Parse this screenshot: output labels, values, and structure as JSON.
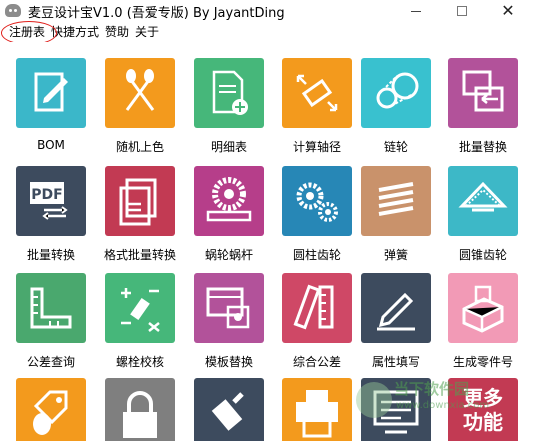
{
  "window": {
    "title": "麦豆设计宝V1.0 (吾爱专版) By JayantDing"
  },
  "menubar": {
    "items": [
      {
        "label": "注册表"
      },
      {
        "label": "快捷方式"
      },
      {
        "label": "赞助"
      },
      {
        "label": "关于"
      }
    ]
  },
  "tiles": [
    {
      "label": "BOM",
      "icon": "edit-document-icon",
      "color": "#3bb7c9"
    },
    {
      "label": "随机上色",
      "icon": "paint-brushes-icon",
      "color": "#f39a1d"
    },
    {
      "label": "明细表",
      "icon": "document-add-icon",
      "color": "#46b77a"
    },
    {
      "label": "计算轴径",
      "icon": "shaft-icon",
      "color": "#f39a1d"
    },
    {
      "label": "链轮",
      "icon": "chain-icon",
      "color": "#39c1cf"
    },
    {
      "label": "批量替换",
      "icon": "replace-icon",
      "color": "#b2529a"
    },
    {
      "label": "批量转换",
      "icon": "pdf-convert-icon",
      "color": "#3d4b5e"
    },
    {
      "label": "格式批量转换",
      "icon": "format-convert-icon",
      "color": "#c23a53"
    },
    {
      "label": "蜗轮蜗杆",
      "icon": "worm-gear-icon",
      "color": "#b63e8a"
    },
    {
      "label": "圆柱齿轮",
      "icon": "spur-gear-icon",
      "color": "#2787b6"
    },
    {
      "label": "弹簧",
      "icon": "spring-icon",
      "color": "#c9926b"
    },
    {
      "label": "圆锥齿轮",
      "icon": "bevel-gear-icon",
      "color": "#3db8c7"
    },
    {
      "label": "公差查询",
      "icon": "ruler-square-icon",
      "color": "#4aa86e"
    },
    {
      "label": "螺栓校核",
      "icon": "bolt-calc-icon",
      "color": "#46b77a"
    },
    {
      "label": "模板替换",
      "icon": "template-icon",
      "color": "#b2529a"
    },
    {
      "label": "综合公差",
      "icon": "ruler-pencil-icon",
      "color": "#cf4866"
    },
    {
      "label": "属性填写",
      "icon": "pencil-line-icon",
      "color": "#3d4b5e"
    },
    {
      "label": "生成零件号",
      "icon": "part-block-icon",
      "color": "#f29ab6"
    },
    {
      "label": "",
      "icon": "tag-icon",
      "color": "#f39a1d"
    },
    {
      "label": "",
      "icon": "lock-icon",
      "color": "#7f7f7f"
    },
    {
      "label": "",
      "icon": "usb-icon",
      "color": "#3d4b5e"
    },
    {
      "label": "",
      "icon": "printer-icon",
      "color": "#f39a1d"
    },
    {
      "label": "",
      "icon": "monitor-icon",
      "color": "#3d4b5e"
    },
    {
      "label": "",
      "icon": "more-icon",
      "color": "#c23a53",
      "text": "更多功能"
    }
  ],
  "watermark": {
    "title": "当下软件园",
    "url": "www.downxia.com"
  }
}
